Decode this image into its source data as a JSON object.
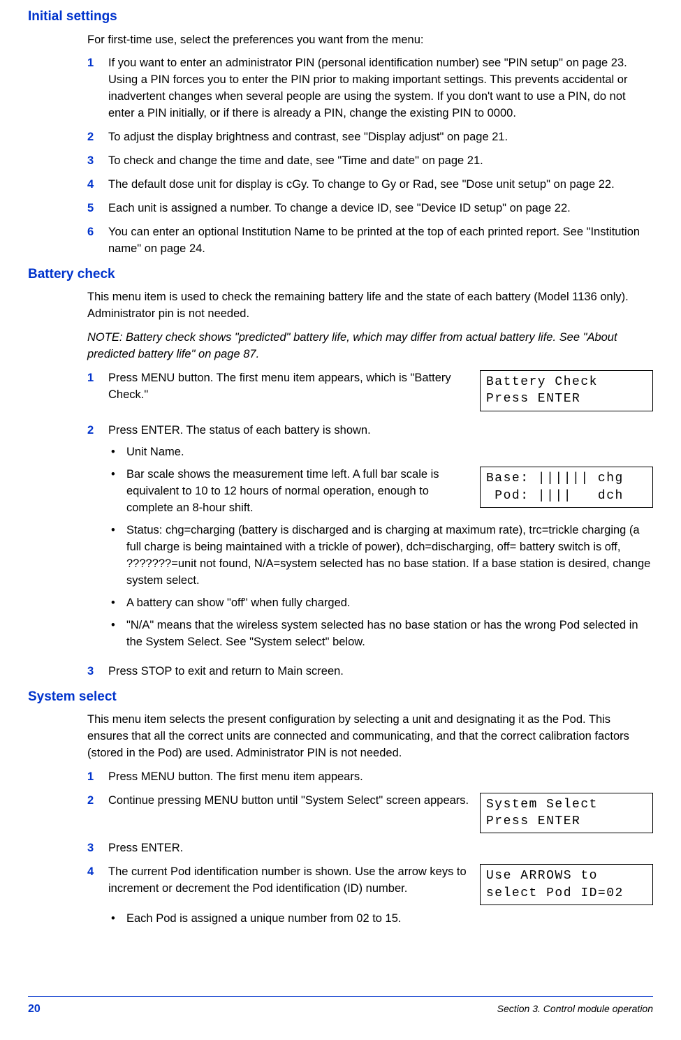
{
  "section1": {
    "heading": "Initial settings",
    "intro": "For first-time use, select the preferences you want from the menu:",
    "items": [
      "If you want to enter an administrator PIN (personal identification number) see \"PIN setup\" on page 23. Using a PIN forces you to enter the PIN prior to making important settings. This prevents accidental or inadvertent changes when several people are using the system. If you don't want to use a PIN, do not enter a PIN initially, or if there is already a PIN, change the existing PIN to 0000.",
      "To adjust the display brightness and contrast, see \"Display adjust\" on page 21.",
      "To check and change the time and date, see \"Time and date\" on page 21.",
      "The default dose unit for display is cGy. To change to Gy or Rad, see \"Dose unit setup\" on page 22.",
      "Each unit is assigned a number. To change a device ID, see \"Device ID setup\" on page 22.",
      "You can enter an optional Institution Name to be printed at the top of each printed report. See \"Institution name\" on page 24."
    ]
  },
  "section2": {
    "heading": "Battery check",
    "intro": "This menu item is used to check the remaining battery life and the state of each battery (Model 1136 only). Administrator pin is not needed.",
    "note": "NOTE: Battery check shows \"predicted\" battery life, which may differ from actual battery life. See \"About predicted battery life\" on page 87.",
    "step1": "Press MENU button. The first menu item appears, which is \"Battery Check.\"",
    "lcd1_l1": "Battery Check",
    "lcd1_l2": "Press ENTER",
    "step2": "Press ENTER. The status of each battery is shown.",
    "bullets": {
      "b1": "Unit Name.",
      "b2": "Bar scale shows the measurement time left. A full bar scale is equivalent to 10 to 12 hours of normal operation, enough to complete an 8-hour shift.",
      "b3": "Status: chg=charging (battery is discharged and is charging at maximum rate), trc=trickle charging (a full charge is being maintained with a trickle of power), dch=discharging, off= battery switch is off, ???????=unit not found, N/A=system selected has no base station. If a base station is desired, change system select.",
      "b4": "A battery can show \"off\" when fully charged.",
      "b5": "\"N/A\" means that the wireless system selected has no base station or has the wrong Pod selected in the System Select. See \"System select\" below."
    },
    "lcd2_l1": "Base: |||||| chg",
    "lcd2_l2": " Pod: ||||   dch",
    "step3": "Press STOP to exit and return to Main screen."
  },
  "section3": {
    "heading": "System select",
    "intro": "This menu item selects the present configuration by selecting a unit and designating it as the Pod. This ensures that all the correct units are connected and communicating, and that the correct calibration factors (stored in the Pod) are used. Administrator PIN is not needed.",
    "step1": "Press MENU button. The first menu item appears.",
    "step2": "Continue pressing MENU button until \"System Select\" screen appears.",
    "lcd1_l1": "System Select",
    "lcd1_l2": "Press ENTER",
    "step3": "Press ENTER.",
    "step4": "The current Pod identification number is shown. Use the arrow keys to increment or decrement the Pod identification (ID) number.",
    "lcd2_l1": "Use ARROWS to",
    "lcd2_l2": "select Pod ID=02",
    "bullet": "Each Pod is assigned a unique number from 02 to 15."
  },
  "footer": {
    "page": "20",
    "right": "Section 3. Control module operation"
  }
}
